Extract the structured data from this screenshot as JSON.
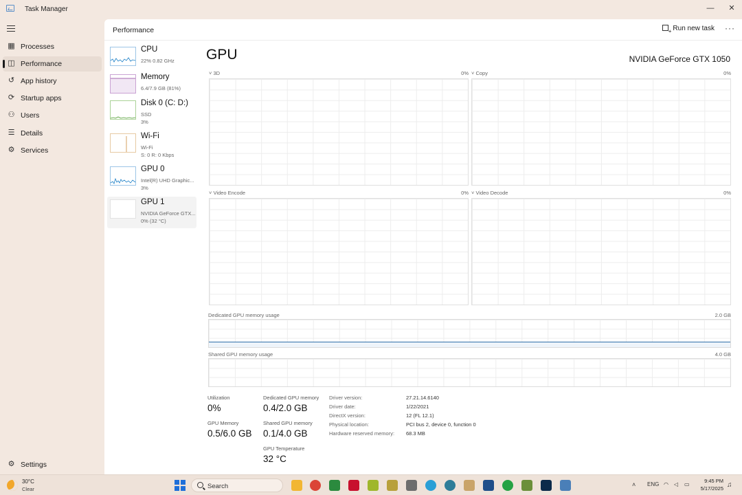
{
  "window": {
    "title": "Task Manager",
    "minimize_glyph": "—",
    "maximize_glyph": "□",
    "close_glyph": "✕"
  },
  "nav": {
    "items": [
      {
        "label": "Processes",
        "icon": "processes-icon",
        "glyph": "▦"
      },
      {
        "label": "Performance",
        "icon": "performance-icon",
        "glyph": "◫",
        "active": true
      },
      {
        "label": "App history",
        "icon": "app-history-icon",
        "glyph": "↺"
      },
      {
        "label": "Startup apps",
        "icon": "startup-icon",
        "glyph": "⟳"
      },
      {
        "label": "Users",
        "icon": "users-icon",
        "glyph": "⚇"
      },
      {
        "label": "Details",
        "icon": "details-icon",
        "glyph": "☰"
      },
      {
        "label": "Services",
        "icon": "services-icon",
        "glyph": "⚙"
      }
    ],
    "settings": {
      "label": "Settings",
      "icon": "settings-icon",
      "glyph": "⚙"
    }
  },
  "header": {
    "title": "Performance",
    "run_new_task": "Run new task",
    "more_glyph": "···"
  },
  "devices": [
    {
      "name": "CPU",
      "line1": "22%  0.82 GHz",
      "line2": "",
      "color": "#1b7fc7"
    },
    {
      "name": "Memory",
      "line1": "6.4/7.9 GB (81%)",
      "line2": "",
      "color": "#8a3a9a"
    },
    {
      "name": "Disk 0 (C: D:)",
      "line1": "SSD",
      "line2": "3%",
      "color": "#4b9a2c"
    },
    {
      "name": "Wi-Fi",
      "line1": "Wi-Fi",
      "line2": "S: 0 R: 0 Kbps",
      "color": "#c98a3a"
    },
    {
      "name": "GPU 0",
      "line1": "Intel(R) UHD Graphic...",
      "line2": "3%",
      "color": "#1b7fc7"
    },
    {
      "name": "GPU 1",
      "line1": "NVIDIA GeForce GTX...",
      "line2": "0% (32 °C)",
      "color": "#1b7fc7",
      "selected": true
    }
  ],
  "gpu": {
    "title": "GPU",
    "model": "NVIDIA GeForce GTX 1050",
    "engines": [
      {
        "label": "3D",
        "pct": "0%"
      },
      {
        "label": "Copy",
        "pct": "0%"
      },
      {
        "label": "Video Encode",
        "pct": "0%"
      },
      {
        "label": "Video Decode",
        "pct": "0%"
      }
    ],
    "dedicated": {
      "label": "Dedicated GPU memory usage",
      "max": "2.0 GB",
      "used_fraction": 0.2
    },
    "shared": {
      "label": "Shared GPU memory usage",
      "max": "4.0 GB",
      "used_fraction": 0.0
    },
    "stats": {
      "utilization_label": "Utilization",
      "utilization": "0%",
      "gpu_memory_label": "GPU Memory",
      "gpu_memory": "0.5/6.0 GB",
      "dedicated_label": "Dedicated GPU memory",
      "dedicated": "0.4/2.0 GB",
      "shared_label": "Shared GPU memory",
      "shared": "0.1/4.0 GB",
      "temp_label": "GPU Temperature",
      "temp": "32 °C"
    },
    "info": [
      {
        "label": "Driver version:",
        "value": "27.21.14.6140"
      },
      {
        "label": "Driver date:",
        "value": "1/22/2021"
      },
      {
        "label": "DirectX version:",
        "value": "12 (FL 12.1)"
      },
      {
        "label": "Physical location:",
        "value": "PCI bus 2, device 0, function 0"
      },
      {
        "label": "Hardware reserved memory:",
        "value": "68.3 MB"
      }
    ]
  },
  "taskbar": {
    "weather_temp": "30°C",
    "weather_desc": "Clear",
    "search_placeholder": "Search",
    "lang": "ENG",
    "time": "9:45 PM",
    "date": "5/17/2025",
    "apps": [
      {
        "name": "start-icon",
        "color": "#1e6fd9"
      },
      {
        "name": "file-explorer-icon",
        "color": "#f2b632"
      },
      {
        "name": "chrome-icon",
        "color": "#db4437"
      },
      {
        "name": "edge-icon",
        "color": "#2b8a3e"
      },
      {
        "name": "acrobat-icon",
        "color": "#c8102e"
      },
      {
        "name": "excel-icon",
        "color": "#9fb72c"
      },
      {
        "name": "app-icon",
        "color": "#b8a03a"
      },
      {
        "name": "calculator-icon",
        "color": "#6d6d6d"
      },
      {
        "name": "telegram-icon",
        "color": "#2a9fd6"
      },
      {
        "name": "browser-icon",
        "color": "#2e7d99"
      },
      {
        "name": "app2-icon",
        "color": "#c9a46a"
      },
      {
        "name": "app3-icon",
        "color": "#1f4e8a"
      },
      {
        "name": "whatsapp-icon",
        "color": "#25a244"
      },
      {
        "name": "app4-icon",
        "color": "#6b8f3a"
      },
      {
        "name": "photoshop-icon",
        "color": "#0b2a4a"
      },
      {
        "name": "task-manager-icon",
        "color": "#4a7fb8"
      }
    ]
  }
}
